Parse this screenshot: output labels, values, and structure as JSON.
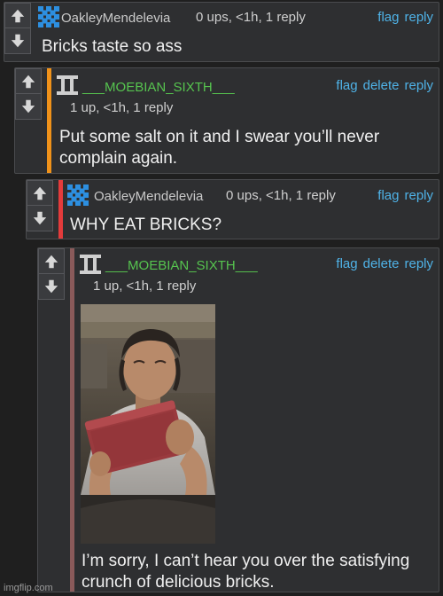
{
  "colors": {
    "background": "#1f1f1f",
    "card": "#2e2f31",
    "link": "#4fb3e8",
    "username_green": "#56c44f",
    "stripe_orange": "#f0921a",
    "stripe_red": "#e43b3b",
    "stripe_brown": "#8a5a5a"
  },
  "comments": [
    {
      "avatar_icon": "pixel-checker-avatar-icon",
      "username": "OakleyMendelevia",
      "meta": "0 ups, <1h, 1 reply",
      "actions": [
        "flag",
        "reply"
      ],
      "text": "Bricks taste so ass"
    },
    {
      "avatar_icon": "roman-two-avatar-icon",
      "username": "___MOEBIAN_SIXTH___",
      "meta": "1 up, <1h, 1 reply",
      "actions": [
        "flag",
        "delete",
        "reply"
      ],
      "text_lines": [
        "Put some salt on it and I swear you’ll never",
        "complain again."
      ]
    },
    {
      "avatar_icon": "pixel-checker-avatar-icon",
      "username": "OakleyMendelevia",
      "meta": "0 ups, <1h, 1 reply",
      "actions": [
        "flag",
        "reply"
      ],
      "text": "WHY EAT BRICKS?"
    },
    {
      "avatar_icon": "roman-two-avatar-icon",
      "username": "___MOEBIAN_SIXTH___",
      "meta": "1 up, <1h, 1 reply",
      "actions": [
        "flag",
        "delete",
        "reply"
      ],
      "image_alt": "man biting a red brick",
      "text_lines": [
        "I’m sorry, I can’t hear you over the satisfying",
        "crunch of delicious bricks."
      ]
    }
  ],
  "footer": "imgflip.com"
}
